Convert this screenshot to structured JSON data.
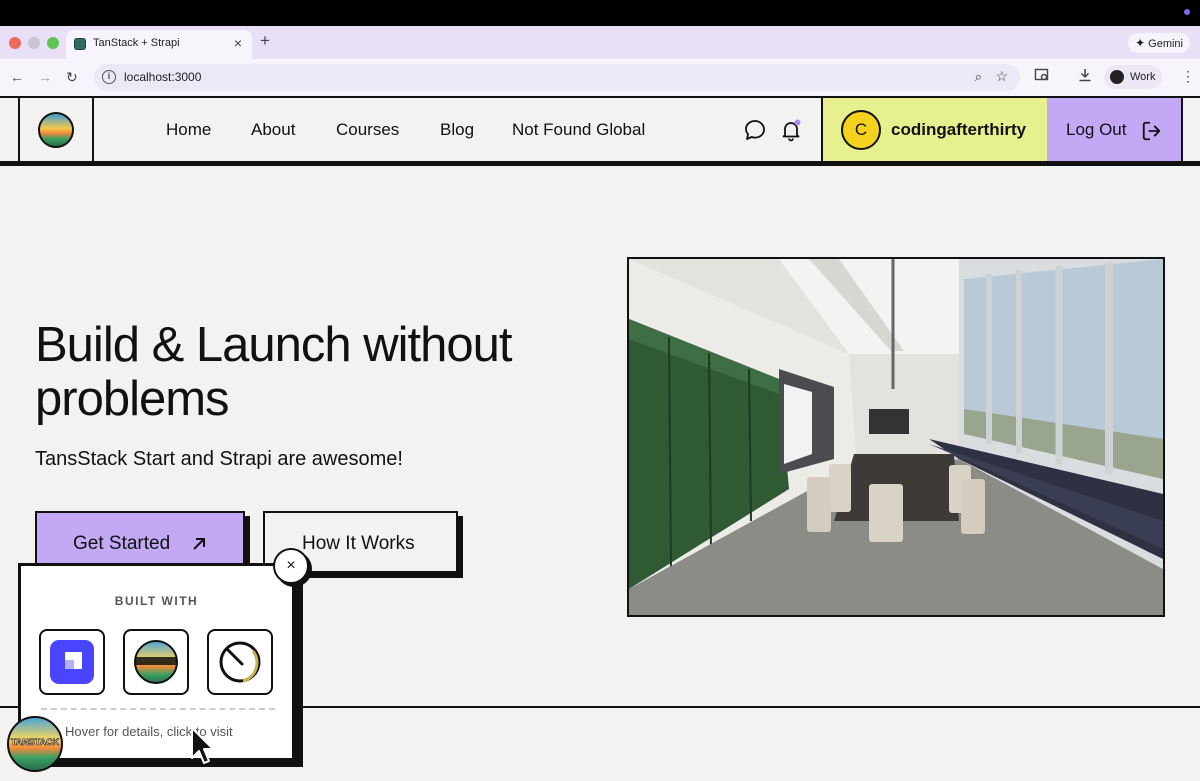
{
  "browser": {
    "tab_title": "TanStack + Strapi",
    "tab_close": "×",
    "new_tab": "+",
    "url": "localhost:3000",
    "gemini_label": "Gemini",
    "profile_label": "Work",
    "back": "←",
    "forward": "→",
    "reload": "↻",
    "menu": "⋮"
  },
  "header": {
    "nav": [
      "Home",
      "About",
      "Courses",
      "Blog",
      "Not Found Global"
    ],
    "user": {
      "initial": "C",
      "name": "codingafterthirty"
    },
    "logout_label": "Log Out"
  },
  "hero": {
    "title": "Build & Launch without problems",
    "subtitle": "TansStack Start and Strapi are awesome!",
    "primary_button": "Get Started",
    "secondary_button": "How It Works"
  },
  "popup": {
    "heading": "BUILT WITH",
    "hint": "Hover for details, click to visit",
    "close": "×",
    "tiles": [
      "strapi-logo-icon",
      "tanstack-logo-icon",
      "react-router-logo-icon"
    ],
    "badge_text": "TANSTACK"
  },
  "colors": {
    "accent_purple": "#c2a8f5",
    "user_yellow_green": "#e6f08e",
    "avatar_yellow": "#f5d21e",
    "page_bg": "#f4f2f1",
    "border": "#111111"
  }
}
